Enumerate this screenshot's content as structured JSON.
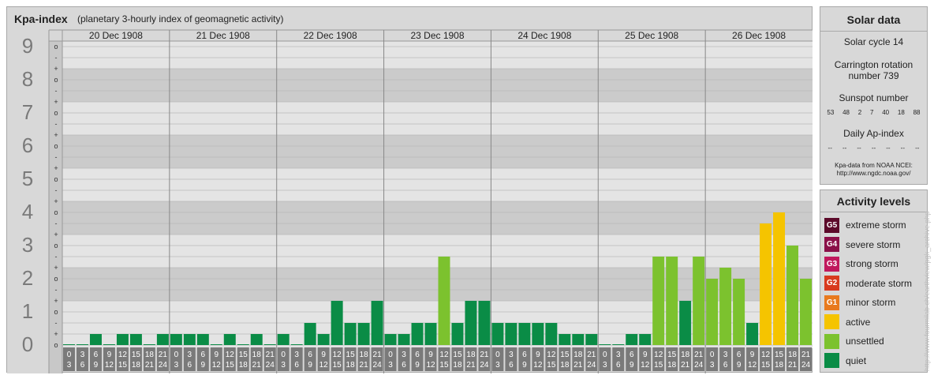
{
  "header": {
    "title": "Kpa-index",
    "subtitle": "(planetary 3-hourly index of geomagnetic activity)"
  },
  "chart_data": {
    "type": "bar",
    "title": "Kpa-index",
    "subtitle": "(planetary 3-hourly index of geomagnetic activity)",
    "ylim": [
      0,
      9
    ],
    "y_ticks": [
      "0",
      "1",
      "2",
      "3",
      "4",
      "5",
      "6",
      "7",
      "8",
      "9"
    ],
    "y_minor_ticks": [
      "o",
      "+",
      "-",
      "o"
    ],
    "days": [
      "20 Dec 1908",
      "21 Dec 1908",
      "22 Dec 1908",
      "23 Dec 1908",
      "24 Dec 1908",
      "25 Dec 1908",
      "26 Dec 1908"
    ],
    "interval_labels": [
      [
        "0",
        "3"
      ],
      [
        "3",
        "6"
      ],
      [
        "6",
        "9"
      ],
      [
        "9",
        "12"
      ],
      [
        "12",
        "15"
      ],
      [
        "15",
        "18"
      ],
      [
        "18",
        "21"
      ],
      [
        "21",
        "24"
      ]
    ],
    "values": [
      [
        0,
        0,
        0.333,
        0,
        0.333,
        0.333,
        0,
        0.333
      ],
      [
        0.333,
        0.333,
        0.333,
        0,
        0.333,
        0,
        0.333,
        0
      ],
      [
        0.333,
        0,
        0.667,
        0.333,
        1.333,
        0.667,
        0.667,
        1.333
      ],
      [
        0.333,
        0.333,
        0.667,
        0.667,
        2.667,
        0.667,
        1.333,
        1.333
      ],
      [
        0.667,
        0.667,
        0.667,
        0.667,
        0.667,
        0.333,
        0.333,
        0.333
      ],
      [
        0,
        0,
        0.333,
        0.333,
        2.667,
        2.667,
        1.333,
        2.667
      ],
      [
        2,
        2.333,
        2,
        0.667,
        3.667,
        4,
        3,
        2
      ]
    ],
    "level_colors": {
      "quiet": "#0a8c46",
      "unsettled": "#7cc22e",
      "active": "#f5c400"
    },
    "grid": true,
    "legend": "right"
  },
  "solar": {
    "title": "Solar data",
    "cycle": "Solar cycle 14",
    "carrington_line1": "Carrington rotation",
    "carrington_line2": "number 739",
    "sunspot_title": "Sunspot number",
    "sunspots": [
      "53",
      "48",
      "2",
      "7",
      "40",
      "18",
      "88"
    ],
    "ap_title": "Daily Ap-index",
    "ap_values": [
      "--",
      "--",
      "--",
      "--",
      "--",
      "--",
      "--"
    ],
    "source_line1": "Kpa-data from NOAA NCEI:",
    "source_line2": "http://www.ngdc.noaa.gov/"
  },
  "levels": {
    "title": "Activity levels",
    "items": [
      {
        "code": "G5",
        "label": "extreme storm",
        "color": "#5c0a2a"
      },
      {
        "code": "G4",
        "label": "severe storm",
        "color": "#8a1048"
      },
      {
        "code": "G3",
        "label": "strong storm",
        "color": "#c0185c"
      },
      {
        "code": "G2",
        "label": "moderate storm",
        "color": "#d83a1e"
      },
      {
        "code": "G1",
        "label": "minor storm",
        "color": "#e87a1e"
      },
      {
        "code": "",
        "label": "active",
        "color": "#f5c400"
      },
      {
        "code": "",
        "label": "unsettled",
        "color": "#7cc22e"
      },
      {
        "code": "",
        "label": "quiet",
        "color": "#0a8c46"
      }
    ]
  },
  "watermark": "http://www.fourmilab.ch/earthview/pgk_archive.php"
}
